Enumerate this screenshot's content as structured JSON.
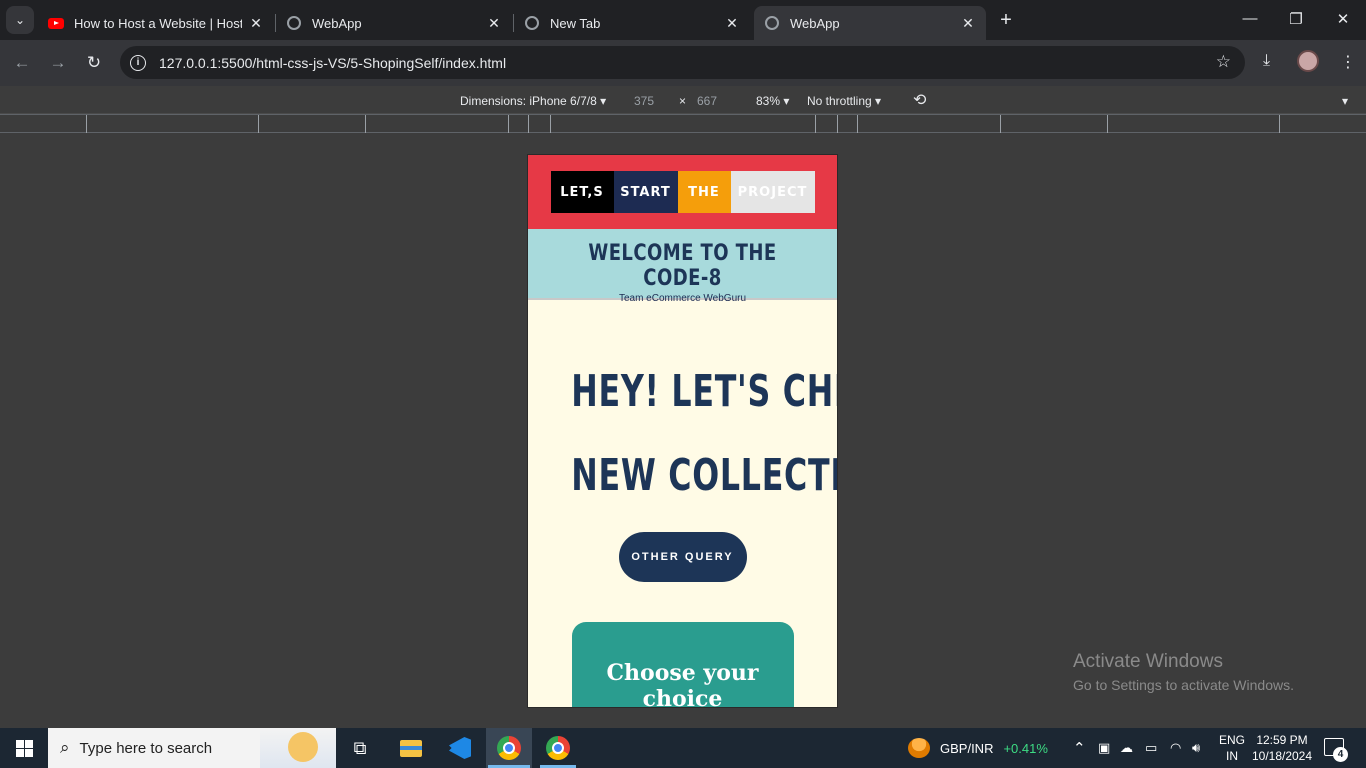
{
  "browser": {
    "tabs": [
      {
        "title": "How to Host a Website | Hostin",
        "favicon": "youtube-icon",
        "active": false
      },
      {
        "title": "WebApp",
        "favicon": "globe-icon",
        "active": false
      },
      {
        "title": "New Tab",
        "favicon": "chrome-icon",
        "active": false
      },
      {
        "title": "WebApp",
        "favicon": "globe-icon",
        "active": true
      }
    ],
    "url": "127.0.0.1:5500/html-css-js-VS/5-ShopingSelf/index.html"
  },
  "devtools": {
    "dimensions_label": "Dimensions: iPhone 6/7/8",
    "width": "375",
    "times": "×",
    "height": "667",
    "zoom": "83%",
    "throttling": "No throttling"
  },
  "site": {
    "header_words": [
      "LET,S",
      "START",
      "THE",
      "PROJECT"
    ],
    "welcome_title": "WELCOME TO THE CODE-8",
    "welcome_subtitle": "Team eCommerce WebGuru",
    "hero_line1": "HEY! LET'S CHECK",
    "hero_line2": "NEW COLLECTION",
    "query_button": "OTHER  QUERY",
    "choice_title": "Choose your choice"
  },
  "watermark": {
    "line1": "Activate Windows",
    "line2": "Go to Settings to activate Windows."
  },
  "taskbar": {
    "search_placeholder": "Type here to search",
    "ticker_symbol": "GBP/INR",
    "ticker_change": "+0.41%",
    "lang_top": "ENG",
    "lang_bottom": "IN",
    "time": "12:59 PM",
    "date": "10/18/2024",
    "notification_count": "4"
  },
  "colors": {
    "header_red": "#e63946",
    "navy": "#1d3557",
    "welcome_bg": "#a8dadc",
    "cream": "#fffbe6",
    "teal": "#2a9d8f",
    "ticker_green": "#3ddc84"
  }
}
